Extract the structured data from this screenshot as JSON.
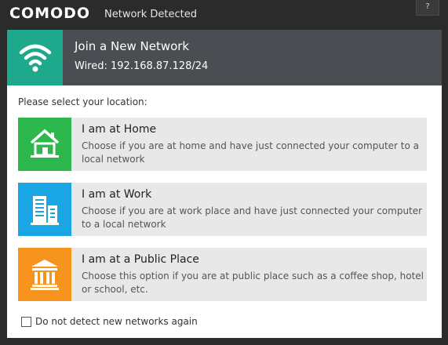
{
  "window": {
    "brand": "COMODO",
    "title": "Network Detected",
    "help_label": "?"
  },
  "header": {
    "title": "Join a New Network",
    "subtitle": "Wired: 192.168.87.128/24",
    "icon": "wifi-icon",
    "icon_bg": "#1fa98c"
  },
  "prompt": "Please select your location:",
  "options": [
    {
      "title": "I am at Home",
      "description": "Choose if you are at home and have just connected your computer to a local network",
      "icon": "home-icon",
      "color": "#2db84d"
    },
    {
      "title": "I am at Work",
      "description": "Choose if you are at work place and have just connected your computer to a local network",
      "icon": "office-building-icon",
      "color": "#1aa6e4"
    },
    {
      "title": "I am at a Public Place",
      "description": "Choose this option if you are at public place such as a coffee shop, hotel or school, etc.",
      "icon": "public-building-icon",
      "color": "#f7941d"
    }
  ],
  "checkbox": {
    "label": "Do not detect new networks again",
    "checked": false
  }
}
